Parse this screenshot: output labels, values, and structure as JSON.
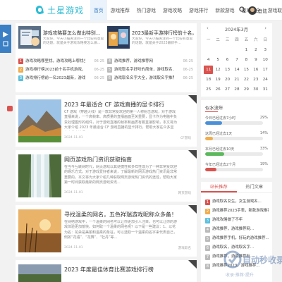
{
  "header": {
    "logo_text": "土星游戏",
    "nav": [
      "首页",
      "游戏推荐",
      "热门游戏",
      "游戏攻略",
      "游戏排行",
      "新款游戏",
      "游戏大全",
      "游戏取名"
    ],
    "login": "登陆"
  },
  "hero": {
    "featured": [
      {
        "title": "游戏攻略要怎么做出特别...",
        "desc": "大家好，今天小编关注到一个比较有意思的话题，就是关于游戏攻略要怎么做..."
      },
      {
        "title": "2023最新手游排行榜前十名，热门...",
        "desc": "大家好，今天小编关注到一个比较有意思的话题，就是关于2023最新手..."
      }
    ],
    "hot_left": [
      {
        "num": "1",
        "text": "游戏攻略哪里找，游戏攻略上哪找全",
        "date": "06-25"
      },
      {
        "num": "2",
        "text": "游戏排行榜2023前十名手机游戏，游戏排行...",
        "date": "06-25"
      },
      {
        "num": "3",
        "text": "游戏排行榜前一名2023最新，游戏排行榜...",
        "date": "06-25"
      }
    ],
    "hot_right": [
      {
        "num": "4",
        "text": "游戏推荐，游戏推荐网",
        "date": "06-25"
      },
      {
        "num": "5",
        "text": "游戏取名字好听的简单，游戏取名...",
        "date": "06-25"
      },
      {
        "num": "6",
        "text": "游戏取名名字大全，游戏取名字推荐",
        "date": "06-25"
      }
    ]
  },
  "posts": [
    {
      "title": "2023 年最适合 CF 游戏直播的显卡排行",
      "excerpt": "CF 游戏（穿越火线）是一款非常受欢迎的第一人称射击游戏，对于游戏直播来说，一个高帧率、高质量的直播画面至关重要，显卡作为电脑中负责处理图形的组件，对于游戏直播的帧率和画质有着直接影响，本文将为大家介绍 2023 年最适合 CF 游戏直播的显卡排行，帮助大家在众多显卡中做出选择...",
      "date": "2024-11-01",
      "cat": "CF游戏"
    },
    {
      "title": "网页游戏热门资讯获取指南",
      "excerpt": "在当今互联网时代，网页游戏以其便捷性和多样性成为了一种非常受欢迎的娱乐方式。对于游戏爱好者来说，了解最新的网页游戏热门资讯是非常重要的。本文将为大家介绍几种获取网页游戏热门资讯的途径，帮助大家第一时间获取最新的网页游戏资讯...",
      "date": "2024-11-01",
      "cat": "网页游戏"
    },
    {
      "title": "寻找温柔的网名，五色祥瑞游戏昵称众多备！",
      "excerpt": "在网络游戏中，一个温柔的网名可以让你更加引人注目，也可以让你的游戏体验更加愉快。如何取一个温柔的网名呢？以下是一些建议：1、以花为名：花朵是美丽和温柔的象征，可以选取一个温柔的名字来代表自己，例如“花语”、“花舞”、“牡丹”等...",
      "date": "2024-11-01",
      "cat": "游戏取名"
    },
    {
      "title": "2023 年度最佳体育比赛游戏排行榜",
      "excerpt": "",
      "date": "",
      "cat": ""
    }
  ],
  "calendar": {
    "title": "2024年3月",
    "weekdays": [
      "一",
      "二",
      "三",
      "四",
      "五",
      "六",
      "日"
    ],
    "days": [
      "",
      "",
      "",
      "",
      "1",
      "2",
      "3",
      "4",
      "5",
      "6",
      "7",
      "8",
      "9",
      "10",
      "11",
      "12",
      "13",
      "14",
      "15",
      "16",
      "17",
      "18",
      "19",
      "20",
      "21",
      "22",
      "23",
      "24",
      "25",
      "26",
      "27",
      "28",
      "29",
      "30",
      "31"
    ],
    "today": "11"
  },
  "progress": {
    "title": "似水流年",
    "rows": [
      {
        "label": "今日已经过去7小时",
        "pct": "29%",
        "value": 0.29,
        "color": "#4a90d9"
      },
      {
        "label": "这周已经过去1天",
        "pct": "14%",
        "value": 0.14,
        "color": "#f0ad4e"
      },
      {
        "label": "本月已经过去10天",
        "pct": "33%",
        "value": 0.33,
        "color": "#5cb85c"
      },
      {
        "label": "今年已经过去2个月",
        "pct": "19%",
        "value": 0.19,
        "color": "#d9534f"
      }
    ]
  },
  "tabs": {
    "labels": [
      "站长推荐",
      "热门文章"
    ],
    "items": [
      {
        "num": "1",
        "text": "游戏取名女生，女生游戏名..."
      },
      {
        "num": "2",
        "text": "游戏推荐2023手表，新款游戏推荐..."
      },
      {
        "num": "3",
        "text": "游戏攻略做了不年"
      },
      {
        "num": "4",
        "text": "游戏推荐，游戏推荐网..."
      },
      {
        "num": "5",
        "text": "游戏推荐手机，好玩的游戏推荐..."
      },
      {
        "num": "6",
        "text": "游戏取名，游戏取名字..."
      },
      {
        "num": "7",
        "text": "游戏推荐，游戏推荐有..."
      },
      {
        "num": "8",
        "text": "游戏推荐2023，游戏推荐..."
      }
    ]
  },
  "watermark": {
    "text": "自动秒收录",
    "sub": "收录·推荐·提升"
  }
}
